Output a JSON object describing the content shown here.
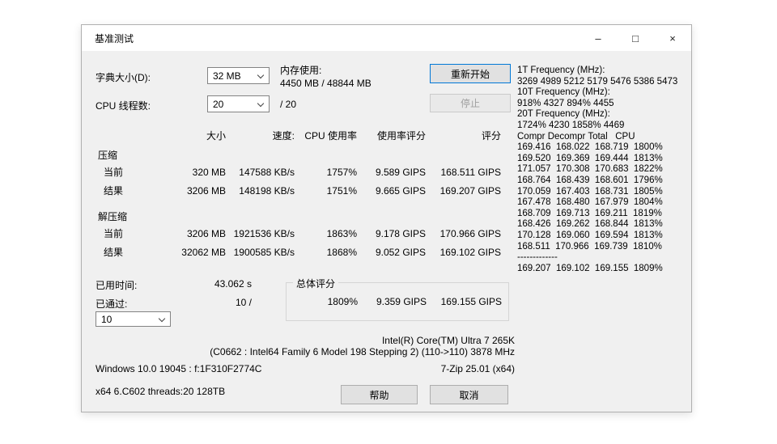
{
  "window": {
    "title": "基准测试",
    "minimize_icon": "–",
    "maximize_icon": "□",
    "close_icon": "×"
  },
  "colors": {
    "accent": "#0078d7",
    "dialog_bg": "#f0f0f0",
    "button_bg": "#e1e1e1"
  },
  "controls": {
    "dictionary_label": "字典大小(D):",
    "dictionary_value": "32 MB",
    "memory_label": "内存使用:",
    "memory_value": "4450 MB / 48844 MB",
    "threads_label": "CPU 线程数:",
    "threads_value": "20",
    "threads_total": "/ 20",
    "restart_button": "重新开始",
    "stop_button": "停止"
  },
  "table": {
    "headers": [
      "大小",
      "速度:",
      "CPU 使用率",
      "使用率评分",
      "评分"
    ],
    "sections": [
      {
        "name": "压缩",
        "rows": [
          {
            "label": "当前",
            "values": [
              "320 MB",
              "147588 KB/s",
              "1757%",
              "9.589 GIPS",
              "168.511 GIPS"
            ]
          },
          {
            "label": "结果",
            "values": [
              "3206 MB",
              "148198 KB/s",
              "1751%",
              "9.665 GIPS",
              "169.207 GIPS"
            ]
          }
        ]
      },
      {
        "name": "解压缩",
        "rows": [
          {
            "label": "当前",
            "values": [
              "3206 MB",
              "1921536 KB/s",
              "1863%",
              "9.178 GIPS",
              "170.966 GIPS"
            ]
          },
          {
            "label": "结果",
            "values": [
              "32062 MB",
              "1900585 KB/s",
              "1868%",
              "9.052 GIPS",
              "169.102 GIPS"
            ]
          }
        ]
      }
    ]
  },
  "status": {
    "elapsed_label": "已用时间:",
    "elapsed_value": "43.062 s",
    "passes_label": "已通过:",
    "passes_value": "10 /",
    "passes_combo_value": "10"
  },
  "total": {
    "label": "总体评分",
    "cpu_usage": "1809%",
    "rating_usage": "9.359 GIPS",
    "rating": "169.155 GIPS"
  },
  "log_panel": {
    "lines": [
      "1T Frequency (MHz):",
      "3269 4989 5212 5179 5476 5386 5473",
      "10T Frequency (MHz):",
      "918% 4327 894% 4455",
      "20T Frequency (MHz):",
      "1724% 4230 1858% 4469",
      "Compr Decompr Total   CPU",
      "169.416  168.022  168.719  1800%",
      "169.520  169.369  169.444  1813%",
      "171.057  170.308  170.683  1822%",
      "168.764  168.439  168.601  1796%",
      "170.059  167.403  168.731  1805%",
      "167.478  168.480  167.979  1804%",
      "168.709  169.713  169.211  1819%",
      "168.426  169.262  168.844  1813%",
      "170.128  169.060  169.594  1813%",
      "168.511  170.966  169.739  1810%",
      "-------------",
      "169.207  169.102  169.155  1809%"
    ]
  },
  "footer": {
    "cpu_name": "Intel(R) Core(TM) Ultra 7 265K",
    "cpu_details": "(C0662 : Intel64 Family 6 Model 198 Stepping 2) (110->110) 3878 MHz",
    "os_info": "Windows 10.0 19045 : f:1F310F2774C",
    "app_info": "7-Zip 25.01 (x64)",
    "build_info": "x64 6.C602 threads:20 128TB",
    "help_button": "帮助",
    "cancel_button": "取消"
  }
}
